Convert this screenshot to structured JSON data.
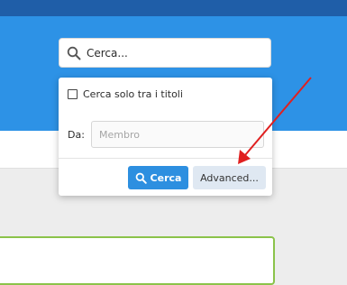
{
  "search": {
    "placeholder": "Cerca..."
  },
  "dropdown": {
    "titles_only_label": "Cerca solo tra i titoli",
    "titles_only_checked": false,
    "by_label": "Da:",
    "member_placeholder": "Membro",
    "search_button_label": "Cerca",
    "advanced_button_label": "Advanced..."
  },
  "icons": {
    "search": "search-icon",
    "search_button": "search-icon",
    "annotation": "red-arrow"
  },
  "colors": {
    "header_blue": "#2d92e6",
    "top_strip": "#1f5ea8",
    "primary_button": "#2d8fe0",
    "secondary_button": "#dfe8f2",
    "annotation_arrow": "#e02020",
    "panel_border": "#8bc34a"
  }
}
